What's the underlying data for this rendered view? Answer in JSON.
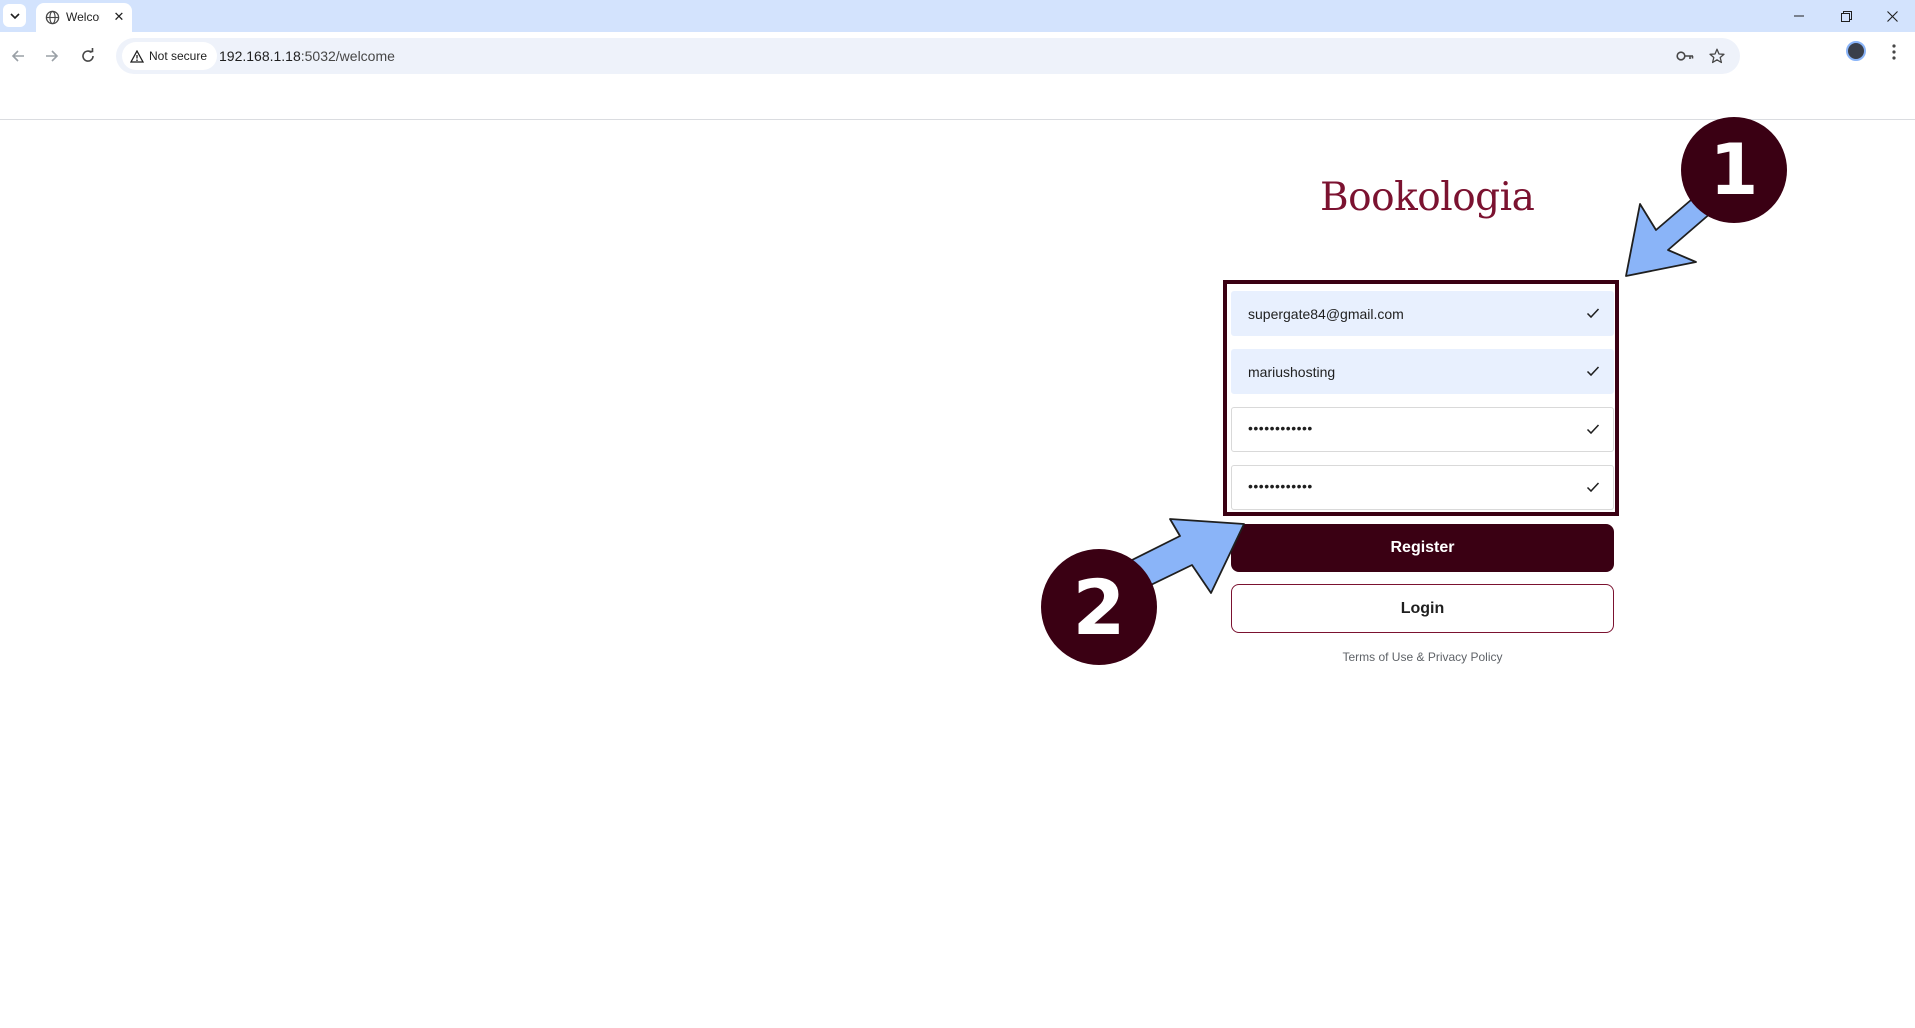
{
  "browser": {
    "tab_title": "Welcome",
    "url_host": "192.168.1.18",
    "url_path": ":5032/welcome",
    "security_chip": "Not secure"
  },
  "page": {
    "logo": "Bookologia",
    "fields": [
      {
        "name": "email",
        "value": "supergate84@gmail.com",
        "filled": true
      },
      {
        "name": "username",
        "value": "mariushosting",
        "filled": true
      },
      {
        "name": "password",
        "value": "••••••••••••",
        "filled": false
      },
      {
        "name": "confirm-password",
        "value": "••••••••••••",
        "filled": false
      }
    ],
    "register_label": "Register",
    "login_label": "Login",
    "terms_text": "Terms of Use & Privacy Policy"
  },
  "annotations": {
    "badge_1": "1",
    "badge_2": "2",
    "badge_color": "#3a0013",
    "arrow_color": "#8ab4f8"
  },
  "colors": {
    "brand": "#7b1230",
    "button_dark": "#3a0013",
    "autofill_bg": "#e8f0fe"
  }
}
